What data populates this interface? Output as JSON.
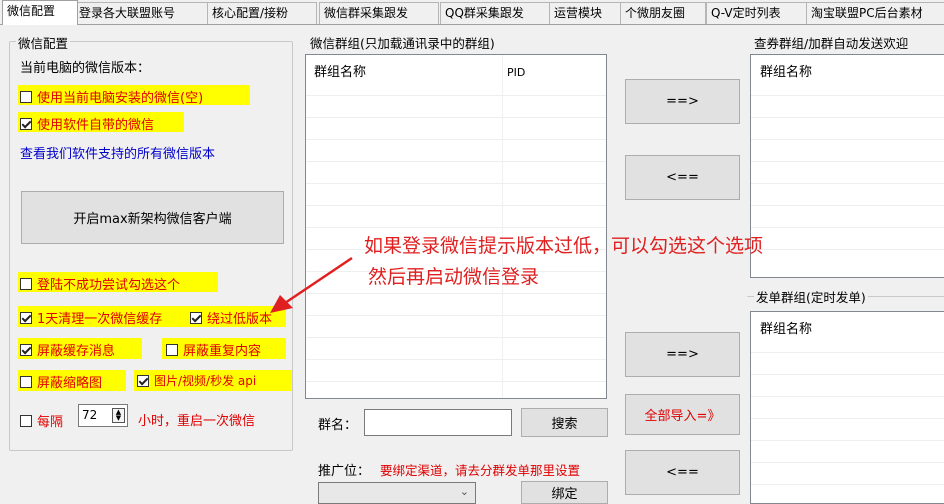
{
  "tabs": [
    "微信配置",
    "登录各大联盟账号",
    "核心配置/接粉",
    "微信群采集跟发",
    "QQ群采集跟发",
    "运营模块",
    "个微朋友圈",
    "Q-V定时列表",
    "淘宝联盟PC后台素材"
  ],
  "config": {
    "title": "微信配置",
    "version_label": "当前电脑的微信版本：",
    "opt_installed": "使用当前电脑安装的微信(空)",
    "opt_builtin": "使用软件自带的微信",
    "view_versions_link": "查看我们软件支持的所有微信版本",
    "launch_button": "开启max新架构微信客户端",
    "retry_check": "登陆不成功尝试勾选这个",
    "clear_cache": "1天清理一次微信缓存",
    "bypass_low_version": "绕过低版本",
    "block_cache_msg": "屏蔽缓存消息",
    "block_dup": "屏蔽重复内容",
    "block_thumbnail": "屏蔽缩略图",
    "image_video": "图片/视频/秒发 api",
    "every_label": "每隔",
    "interval_value": "72",
    "restart_text": "小时，重启一次微信"
  },
  "group_list": {
    "title": "微信群组(只加载通讯录中的群组)",
    "col_name": "群组名称",
    "col_pid": "PID",
    "name_label": "群名：",
    "search_button": "搜索",
    "promo_label": "推广位：",
    "promo_hint": "要绑定渠道，请去分群发单那里设置",
    "bind_button": "绑定"
  },
  "middle": {
    "add_button_1": "==>",
    "remove_button_1": "<==",
    "add_button_2": "==>",
    "import_all_button": "全部导入=》",
    "remove_button_2": "<=="
  },
  "right": {
    "coupon_title": "查券群组/加群自动发送欢迎",
    "coupon_col": "群组名称",
    "send_title": "发单群组(定时发单)",
    "send_col": "群组名称"
  },
  "annotation": {
    "line1": "如果登录微信提示版本过低，可以勾选这个选项",
    "line2": "然后再启动微信登录"
  },
  "colors": {
    "highlight": "#ffff00",
    "annotation": "#e02020"
  }
}
